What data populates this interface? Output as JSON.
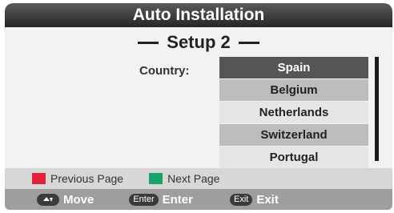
{
  "title": "Auto  Installation",
  "subtitle": "Setup 2",
  "country_label": "Country:",
  "countries": [
    "Spain",
    "Belgium",
    "Netherlands",
    "Switzerland",
    "Portugal"
  ],
  "selected_index": 0,
  "hints": {
    "previous_page": "Previous Page",
    "next_page": "Next Page",
    "previous_color": "#e0223a",
    "next_color": "#1aa36a"
  },
  "controls": {
    "move_key_icon": "up-down-arrows-icon",
    "move_label": "Move",
    "enter_key": "Enter",
    "enter_label": "Enter",
    "exit_key": "Exit",
    "exit_label": "Exit"
  }
}
